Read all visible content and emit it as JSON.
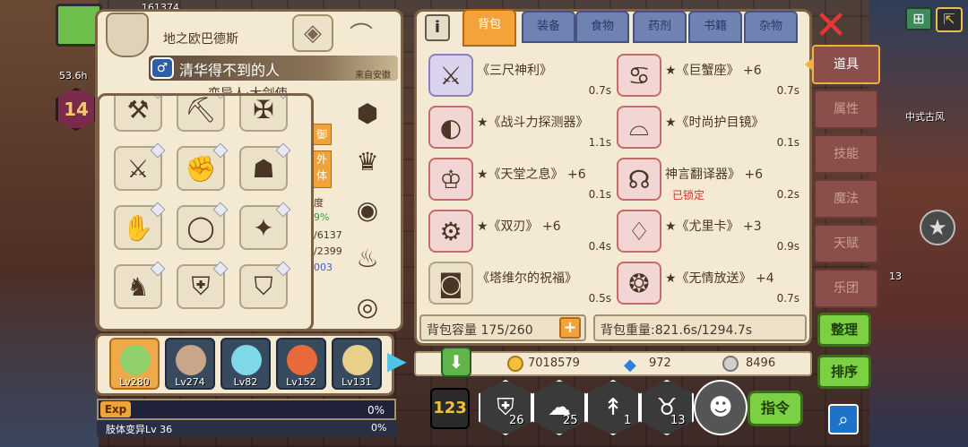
{
  "hud": {
    "top_stat": "161374",
    "rate": "53.6h",
    "level": "14",
    "map_label": "中式古风",
    "side_num": "13"
  },
  "character": {
    "name": "地之欧巴德斯",
    "title": "清华得不到的人",
    "from": "来自安徽",
    "subtitle": "变异人·大剑使",
    "peek": {
      "btn1": "御",
      "btn2a": "外",
      "btn2b": "体",
      "line1": "度",
      "line2": "9%",
      "line3": "/6137",
      "line4": "/2399",
      "line5": "003"
    },
    "equipment": [
      "axe",
      "pickaxe",
      "crossbow",
      "great-axe",
      "gauntlet",
      "red-helm",
      "fist-glove",
      "jade-ring",
      "claw",
      "boots",
      "red-armor",
      "purple-armor"
    ]
  },
  "party": [
    {
      "level": "Lv280"
    },
    {
      "level": "Lv274"
    },
    {
      "level": "Lv82"
    },
    {
      "level": "Lv152"
    },
    {
      "level": "Lv131"
    }
  ],
  "exp": {
    "label": "Exp",
    "percent": "0%"
  },
  "skill": {
    "label": "肢体变异Lv 36",
    "percent": "0%"
  },
  "tabs": [
    "背包",
    "装备",
    "食物",
    "药剂",
    "书籍",
    "杂物"
  ],
  "active_tab": "背包",
  "items": [
    {
      "name": "《三尺神利》",
      "weight": "0.7s",
      "locked": ""
    },
    {
      "name": "★《巨蟹座》  +6",
      "weight": "0.7s",
      "locked": ""
    },
    {
      "name": "★《战斗力探测器》",
      "weight": "1.1s",
      "locked": ""
    },
    {
      "name": "★《时尚护目镜》",
      "weight": "0.1s",
      "locked": ""
    },
    {
      "name": "★《天堂之息》  +6",
      "weight": "0.1s",
      "locked": ""
    },
    {
      "name": "神言翻译器》  +6",
      "weight": "0.2s",
      "locked": "已锁定"
    },
    {
      "name": "★《双刃》  +6",
      "weight": "0.4s",
      "locked": ""
    },
    {
      "name": "★《尤里卡》  +3",
      "weight": "0.9s",
      "locked": ""
    },
    {
      "name": "《塔维尔的祝福》",
      "weight": "0.5s",
      "locked": ""
    },
    {
      "name": "★《无情放送》  +4",
      "weight": "0.7s",
      "locked": ""
    }
  ],
  "bag": {
    "capacity_label": "背包容量 175/260",
    "weight_label": "背包重量:821.6s/1294.7s"
  },
  "currency": {
    "gold": "7018579",
    "diamond": "972",
    "silver": "8496"
  },
  "quick_slots": [
    {
      "count": "26"
    },
    {
      "count": "25"
    },
    {
      "count": "1"
    },
    {
      "count": "13"
    }
  ],
  "command_label": "指令",
  "sort_label": "123",
  "side_menu": [
    "道具",
    "属性",
    "技能",
    "魔法",
    "天赋",
    "乐团"
  ],
  "active_menu": "道具",
  "organize_label": "整理",
  "order_label": "排序",
  "colors": {
    "accent": "#f4a23a",
    "panel": "#f4ead3",
    "tab": "#7082b2",
    "lock": "#d32f2f"
  }
}
